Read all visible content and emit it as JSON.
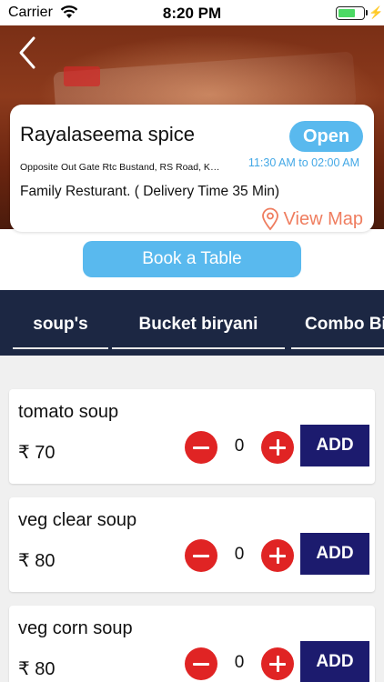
{
  "status_bar": {
    "carrier": "Carrier",
    "time": "8:20 PM"
  },
  "restaurant": {
    "name": "Rayalaseema spice",
    "status": "Open",
    "address": "Opposite Out Gate Rtc Bustand, RS Road, Kadapa",
    "timings": "11:30 AM to 02:00 AM",
    "description": "Family Resturant. ( Delivery Time 35 Min)",
    "view_map_label": "View Map"
  },
  "book_table_label": "Book a Table",
  "categories": [
    "soup's",
    "Bucket biryani",
    "Combo Biryani"
  ],
  "menu_items": [
    {
      "name": "tomato soup",
      "price": "₹ 70",
      "quantity": "0",
      "add_label": "ADD"
    },
    {
      "name": "veg clear soup",
      "price": "₹ 80",
      "quantity": "0",
      "add_label": "ADD"
    },
    {
      "name": "veg corn soup",
      "price": "₹ 80",
      "quantity": "0",
      "add_label": "ADD"
    }
  ],
  "colors": {
    "accent_blue": "#59b9ee",
    "tab_bar": "#1c2743",
    "add_button": "#1c1b6e",
    "qty_button": "#e02424",
    "map_link": "#ef7d5f"
  }
}
